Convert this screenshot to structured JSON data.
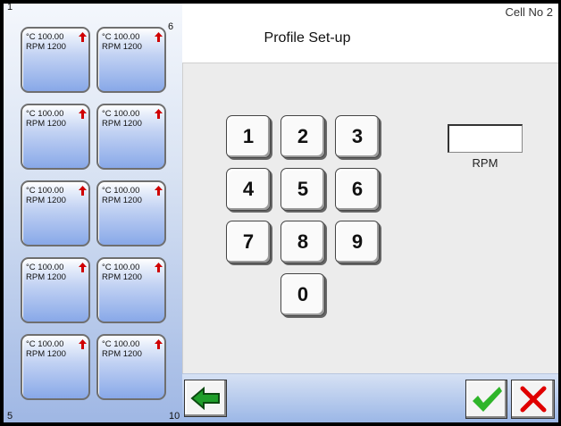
{
  "header": {
    "title": "Profile Set-up",
    "cell_label": "Cell No 2"
  },
  "sidebar": {
    "corner_top_left": "1",
    "corner_top_right": "6",
    "corner_bottom_left": "5",
    "corner_bottom_right": "10",
    "tiles": [
      {
        "temp": "°C 100.00",
        "rpm": "RPM 1200",
        "icon": "red-up-arrow-icon"
      },
      {
        "temp": "°C 100.00",
        "rpm": "RPM 1200",
        "icon": "red-up-arrow-icon"
      },
      {
        "temp": "°C 100.00",
        "rpm": "RPM 1200",
        "icon": "red-up-arrow-icon"
      },
      {
        "temp": "°C 100.00",
        "rpm": "RPM 1200",
        "icon": "red-up-arrow-icon"
      },
      {
        "temp": "°C 100.00",
        "rpm": "RPM 1200",
        "icon": "red-up-arrow-icon"
      },
      {
        "temp": "°C 100.00",
        "rpm": "RPM 1200",
        "icon": "red-up-arrow-icon"
      },
      {
        "temp": "°C 100.00",
        "rpm": "RPM 1200",
        "icon": "red-up-arrow-icon"
      },
      {
        "temp": "°C 100.00",
        "rpm": "RPM 1200",
        "icon": "red-up-arrow-icon"
      },
      {
        "temp": "°C 100.00",
        "rpm": "RPM 1200",
        "icon": "red-up-arrow-icon"
      },
      {
        "temp": "°C 100.00",
        "rpm": "RPM 1200",
        "icon": "red-up-arrow-icon"
      }
    ]
  },
  "keypad": {
    "keys": [
      "1",
      "2",
      "3",
      "4",
      "5",
      "6",
      "7",
      "8",
      "9",
      "0"
    ]
  },
  "rpm_field": {
    "value": "",
    "label": "RPM"
  },
  "buttons": {
    "back": "back-arrow-icon",
    "confirm": "checkmark-icon",
    "cancel": "close-icon"
  },
  "colors": {
    "arrow_red": "#d00000",
    "check_green": "#2fb52a",
    "back_green": "#1f9e2a",
    "cancel_red": "#e00000",
    "tile_blue": "#9ab3ea"
  }
}
